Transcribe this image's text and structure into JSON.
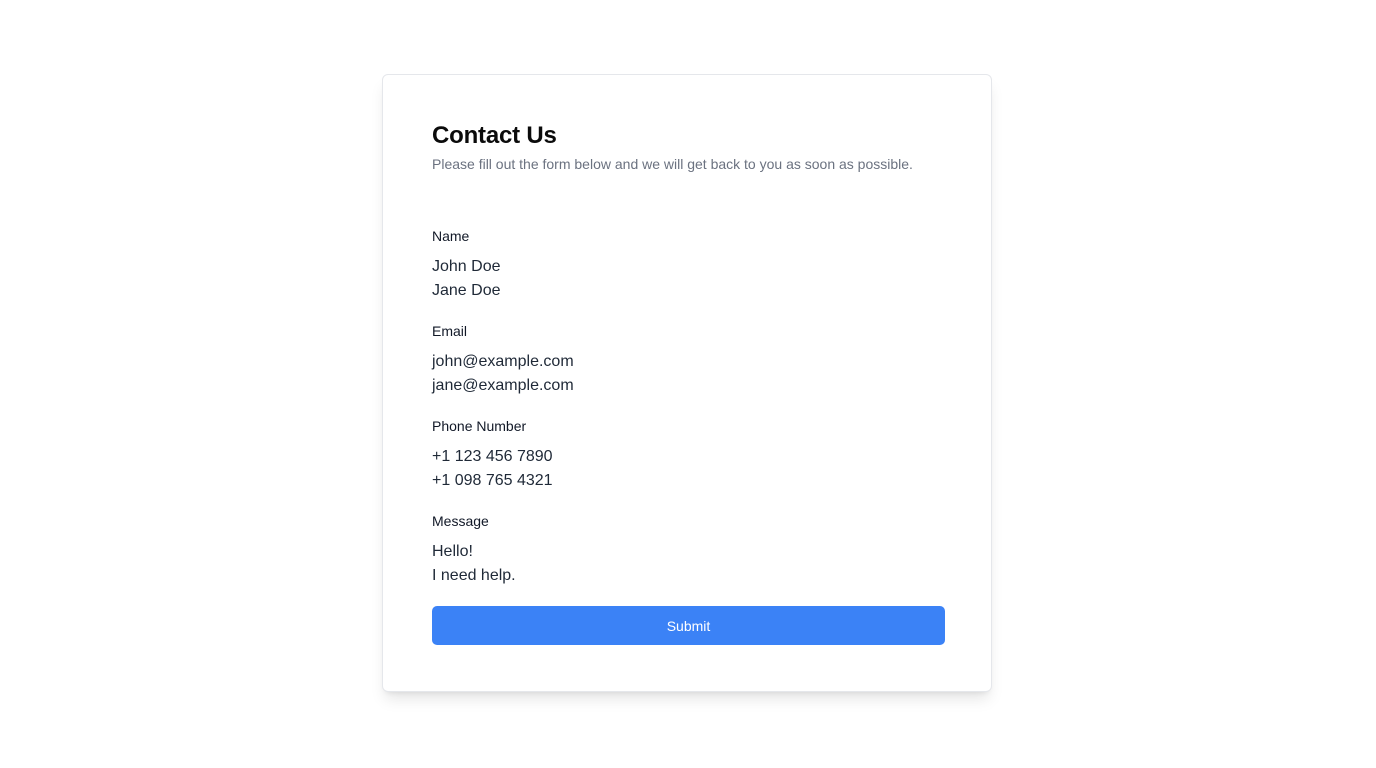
{
  "form": {
    "title": "Contact Us",
    "subtitle": "Please fill out the form below and we will get back to you as soon as possible.",
    "fields": [
      {
        "label": "Name",
        "values": [
          "John Doe",
          "Jane Doe"
        ]
      },
      {
        "label": "Email",
        "values": [
          "john@example.com",
          "jane@example.com"
        ]
      },
      {
        "label": "Phone Number",
        "values": [
          "+1 123 456 7890",
          "+1 098 765 4321"
        ]
      },
      {
        "label": "Message",
        "values": [
          "Hello!",
          "I need help."
        ]
      }
    ],
    "submit_label": "Submit"
  },
  "colors": {
    "accent": "#3b82f6",
    "subtitle": "#6b7280",
    "border": "#e5e7eb"
  }
}
